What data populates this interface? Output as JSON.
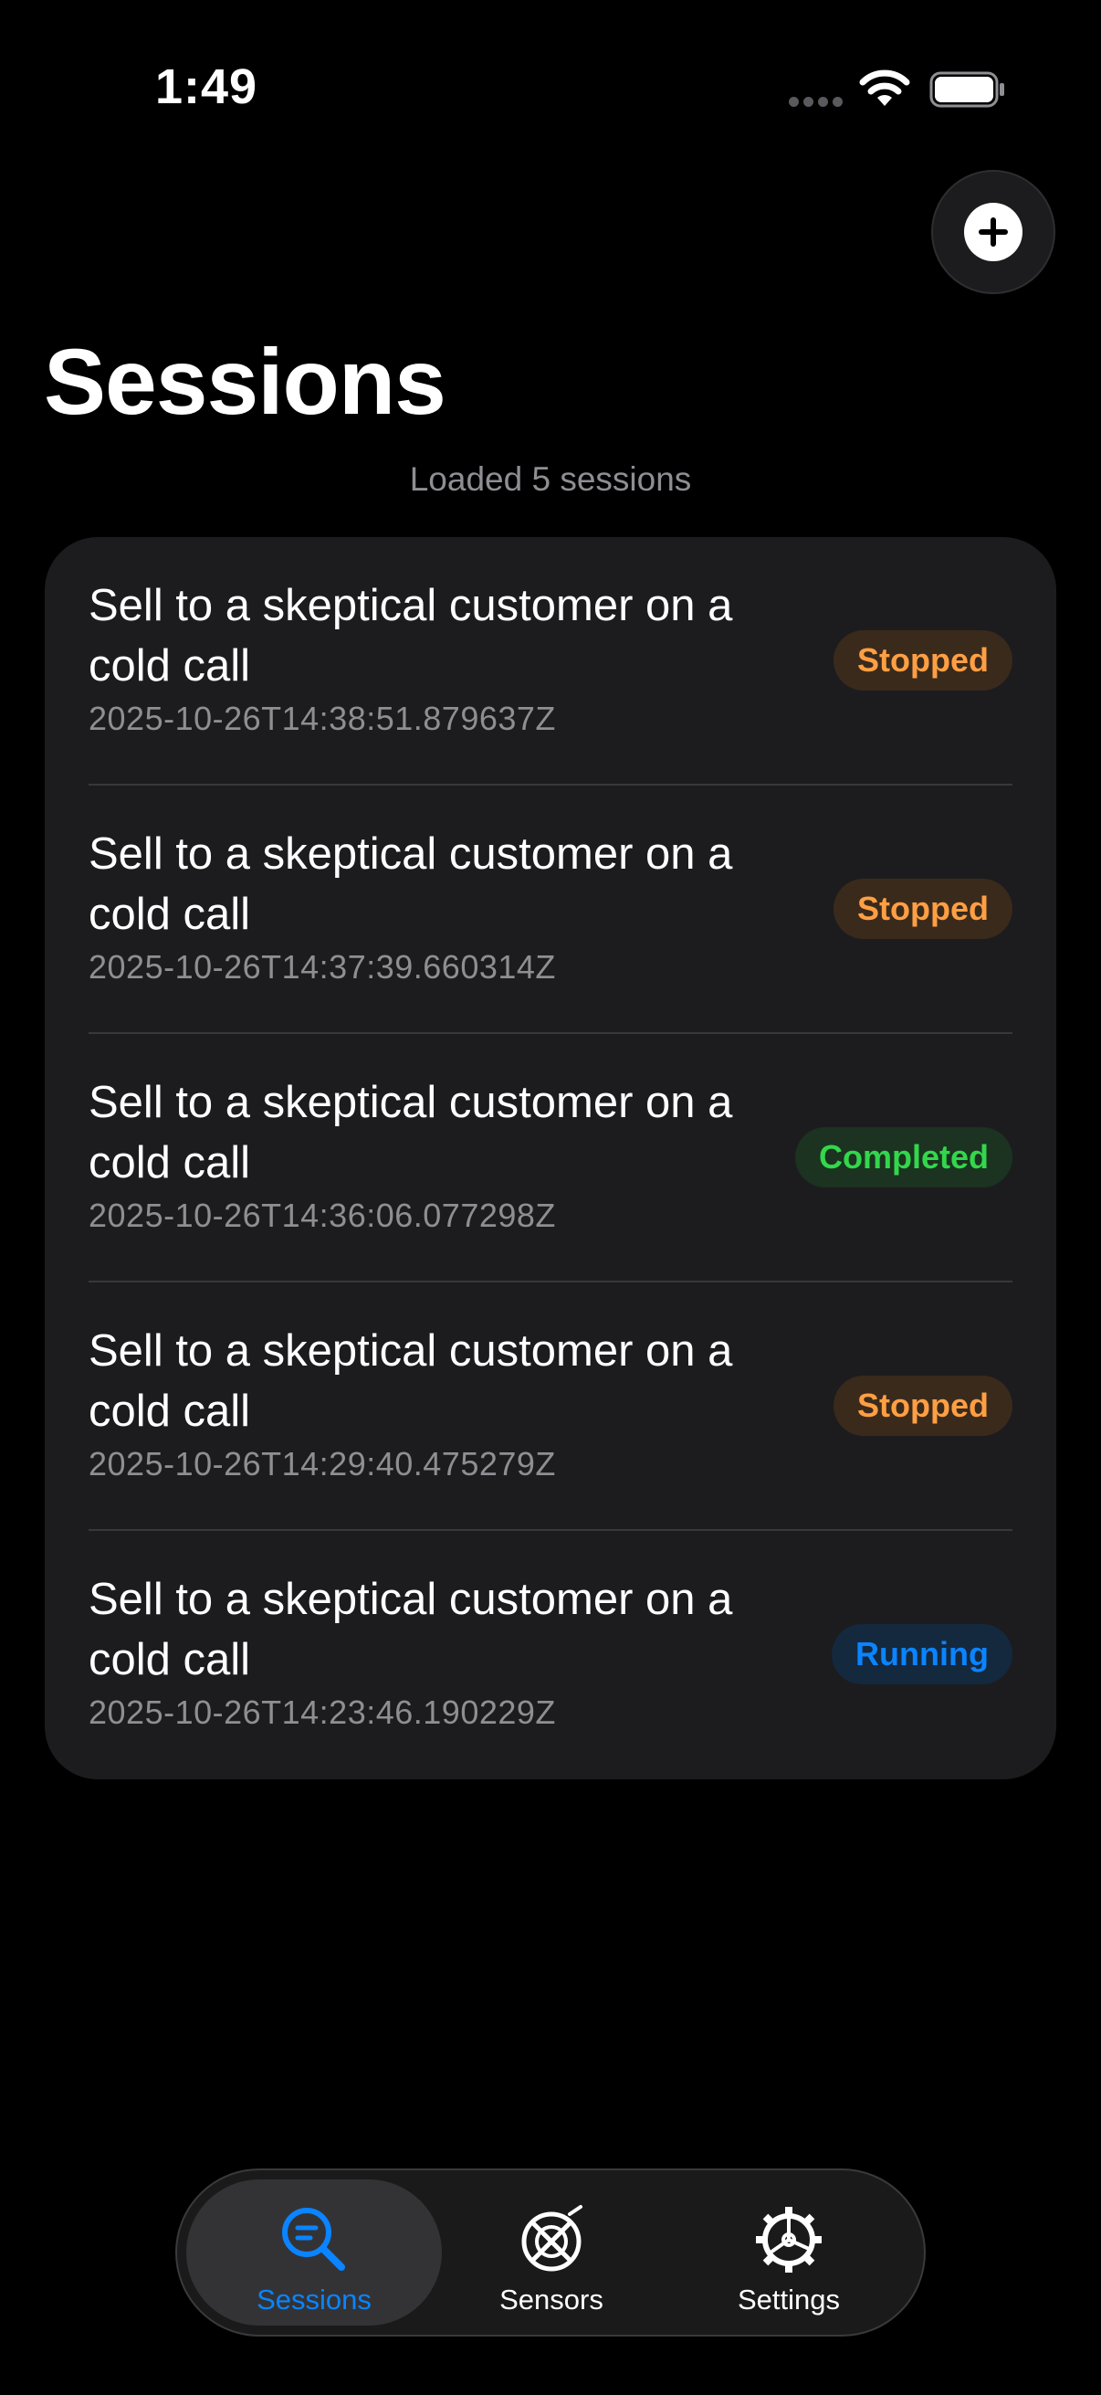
{
  "status_bar": {
    "time": "1:49"
  },
  "header": {
    "title": "Sessions",
    "add_button_icon": "plus-icon",
    "load_status": "Loaded 5 sessions"
  },
  "sessions": [
    {
      "title": "Sell to a skeptical customer on a cold call",
      "timestamp": "2025-10-26T14:38:51.879637Z",
      "status": "Stopped"
    },
    {
      "title": "Sell to a skeptical customer on a cold call",
      "timestamp": "2025-10-26T14:37:39.660314Z",
      "status": "Stopped"
    },
    {
      "title": "Sell to a skeptical customer on a cold call",
      "timestamp": "2025-10-26T14:36:06.077298Z",
      "status": "Completed"
    },
    {
      "title": "Sell to a skeptical customer on a cold call",
      "timestamp": "2025-10-26T14:29:40.475279Z",
      "status": "Stopped"
    },
    {
      "title": "Sell to a skeptical customer on a cold call",
      "timestamp": "2025-10-26T14:23:46.190229Z",
      "status": "Running"
    }
  ],
  "tab_bar": {
    "tabs": [
      {
        "label": "Sessions",
        "icon": "search-list-icon",
        "active": true
      },
      {
        "label": "Sensors",
        "icon": "sensor-icon",
        "active": false
      },
      {
        "label": "Settings",
        "icon": "gear-icon",
        "active": false
      }
    ]
  },
  "colors": {
    "background": "#000000",
    "card": "#1c1c1e",
    "accent": "#0a84ff",
    "stopped": "#ff9f43",
    "completed": "#32d74b",
    "running": "#0a84ff",
    "secondary_text": "#8e8e93"
  }
}
